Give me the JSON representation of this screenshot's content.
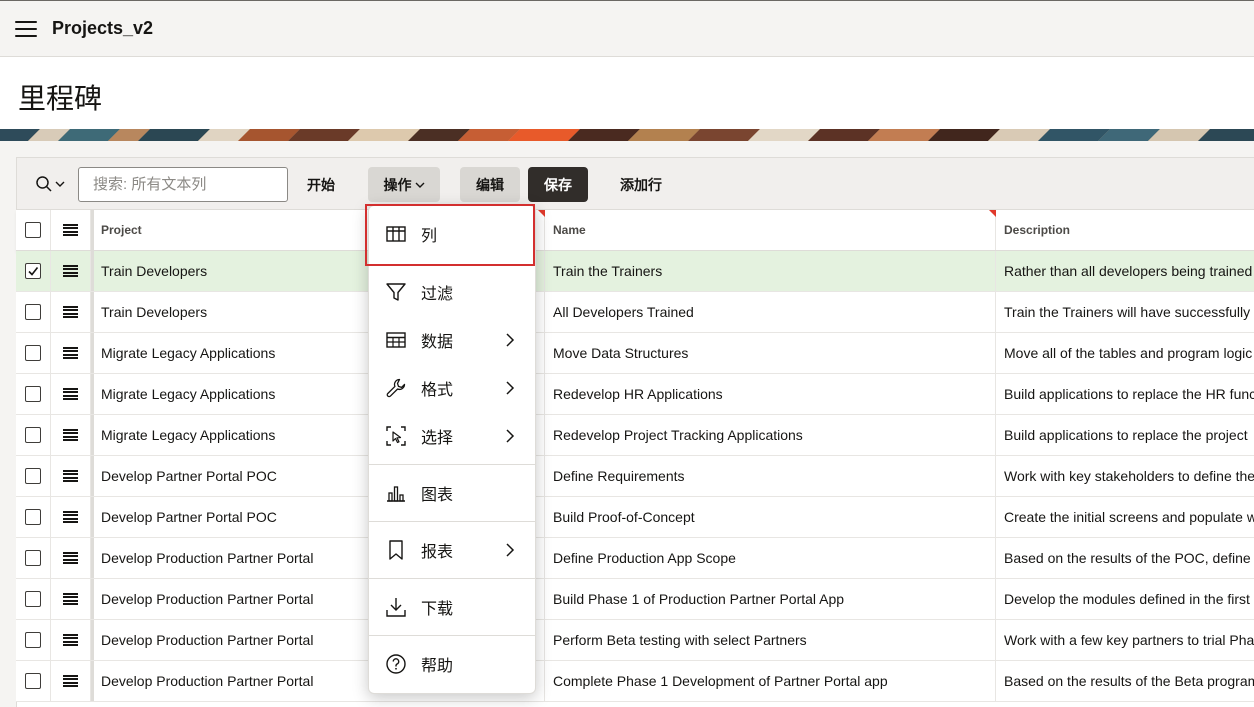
{
  "app": {
    "title": "Projects_v2"
  },
  "page": {
    "title": "里程碑"
  },
  "toolbar": {
    "search_placeholder": "搜索: 所有文本列",
    "start_label": "开始",
    "actions_label": "操作",
    "edit_label": "编辑",
    "save_label": "保存",
    "add_row_label": "添加行"
  },
  "grid": {
    "columns": {
      "project": "Project",
      "name": "Name",
      "description": "Description"
    },
    "rows": [
      {
        "project": "Train Developers",
        "name": "Train the Trainers",
        "description": "Rather than all developers being trained",
        "selected": true
      },
      {
        "project": "Train Developers",
        "name": "All Developers Trained",
        "description": "Train the Trainers will have successfully",
        "selected": false
      },
      {
        "project": "Migrate Legacy Applications",
        "name": "Move Data Structures",
        "description": "Move all of the tables and program logic",
        "selected": false
      },
      {
        "project": "Migrate Legacy Applications",
        "name": "Redevelop HR Applications",
        "description": "Build applications to replace the HR func",
        "selected": false
      },
      {
        "project": "Migrate Legacy Applications",
        "name": "Redevelop Project Tracking Applications",
        "description": "Build applications to replace the project",
        "selected": false
      },
      {
        "project": "Develop Partner Portal POC",
        "name": "Define Requirements",
        "description": "Work with key stakeholders to define the",
        "selected": false
      },
      {
        "project": "Develop Partner Portal POC",
        "name": "Build Proof-of-Concept",
        "description": "Create the initial screens and populate w",
        "selected": false
      },
      {
        "project": "Develop Production Partner Portal",
        "name": "Define Production App Scope",
        "description": "Based on the results of the POC, define t",
        "selected": false
      },
      {
        "project": "Develop Production Partner Portal",
        "name": "Build Phase 1 of Production Partner Portal App",
        "description": "Develop the modules defined in the first",
        "selected": false
      },
      {
        "project": "Develop Production Partner Portal",
        "name": "Perform Beta testing with select Partners",
        "description": "Work with a few key partners to trial Pha",
        "selected": false
      },
      {
        "project": "Develop Production Partner Portal",
        "name": "Complete Phase 1 Development of Partner Portal app",
        "description": "Based on the results of the Beta program",
        "selected": false
      }
    ]
  },
  "actions_menu": {
    "items": [
      {
        "label": "列",
        "icon": "columns-icon",
        "submenu": false,
        "focused": true
      },
      {
        "label": "过滤",
        "icon": "filter-icon",
        "submenu": false
      },
      {
        "label": "数据",
        "icon": "table-data-icon",
        "submenu": true
      },
      {
        "label": "格式",
        "icon": "wrench-icon",
        "submenu": true
      },
      {
        "label": "选择",
        "icon": "selection-icon",
        "submenu": true
      },
      {
        "label": "图表",
        "icon": "bar-chart-icon",
        "submenu": false
      },
      {
        "label": "报表",
        "icon": "bookmark-icon",
        "submenu": true
      },
      {
        "label": "下载",
        "icon": "download-icon",
        "submenu": false
      },
      {
        "label": "帮助",
        "icon": "help-icon",
        "submenu": false
      }
    ]
  },
  "colors": {
    "save_bg": "#312d2a",
    "selected_row": "#e4f2df",
    "focus_outline": "#d32f2f"
  }
}
